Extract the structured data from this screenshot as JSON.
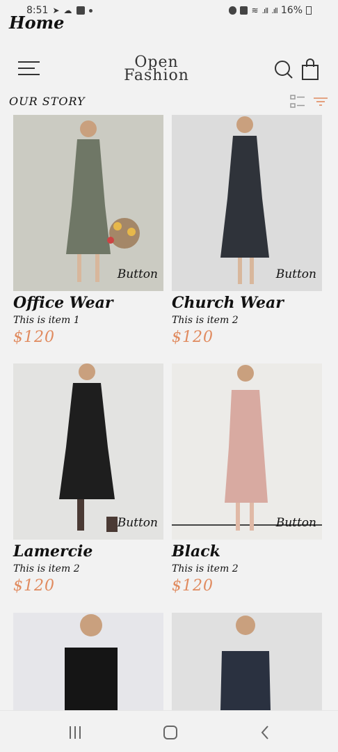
{
  "status_bar": {
    "time": "8:51",
    "battery": "16%"
  },
  "header": {
    "page_title": "Home",
    "logo_line1": "Open",
    "logo_line2": "Fashion"
  },
  "section": {
    "title": "OUR STORY"
  },
  "products": [
    {
      "name": "Office Wear",
      "subtitle": "This is item 1",
      "price": "$120",
      "button_label": "Button",
      "bg": "#cbcbc2",
      "dress": "#6f7766"
    },
    {
      "name": "Church Wear",
      "subtitle": "This is item 2",
      "price": "$120",
      "button_label": "Button",
      "bg": "#dcdcdc",
      "dress": "#2f333a"
    },
    {
      "name": "Lamercie",
      "subtitle": "This is item 2",
      "price": "$120",
      "button_label": "Button",
      "bg": "#e3e3e1",
      "dress": "#1e1e1e"
    },
    {
      "name": "Black",
      "subtitle": "This is item 2",
      "price": "$120",
      "button_label": "Button",
      "bg": "#ecebe8",
      "dress": "#d8aaa1"
    }
  ],
  "partial_products": [
    {
      "bg": "#e6e6ea",
      "dress": "#151515"
    },
    {
      "bg": "#e0e0e0",
      "dress": "#2a3140"
    }
  ],
  "colors": {
    "price": "#e08a5e",
    "background": "#f2f2f2"
  }
}
